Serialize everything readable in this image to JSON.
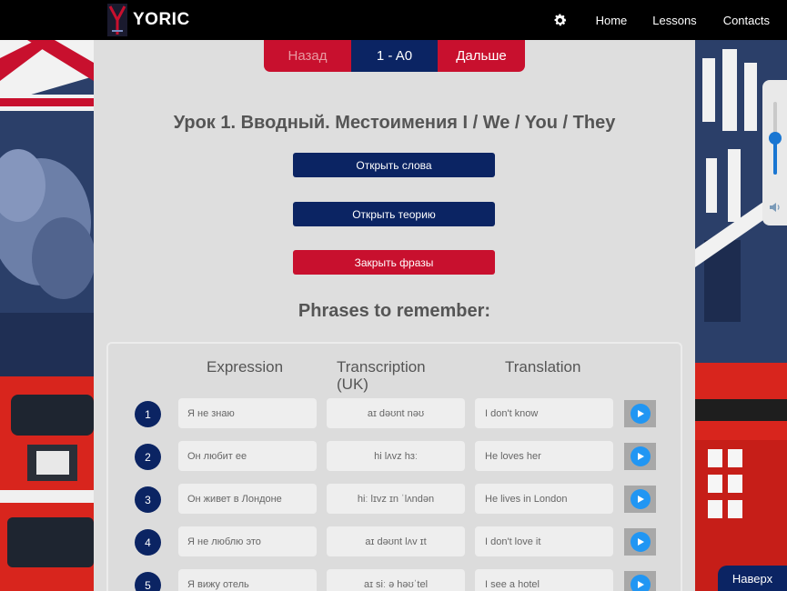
{
  "header": {
    "brand": "YORIC",
    "nav": {
      "home": "Home",
      "lessons": "Lessons",
      "contacts": "Contacts"
    }
  },
  "pager": {
    "prev": "Назад",
    "current": "1 - A0",
    "next": "Дальше"
  },
  "lesson_title": "Урок 1. Вводный. Местоимения I / We / You / They",
  "buttons": {
    "words": "Открыть слова",
    "theory": "Открыть теорию",
    "phrases": "Закрыть фразы"
  },
  "section_title": "Phrases to remember:",
  "table": {
    "headers": {
      "expression": "Expression",
      "transcription": "Transcription (UK)",
      "translation": "Translation"
    },
    "rows": [
      {
        "num": "1",
        "expression": "Я не знаю",
        "transcription": "aɪ dəʊnt nəʊ",
        "translation": "I don't know"
      },
      {
        "num": "2",
        "expression": "Он любит ее",
        "transcription": "hi lʌvz hɜː",
        "translation": "He loves her"
      },
      {
        "num": "3",
        "expression": "Он живет в Лондоне",
        "transcription": "hiː lɪvz ɪn ˈlʌndən",
        "translation": "He lives in London"
      },
      {
        "num": "4",
        "expression": "Я не люблю это",
        "transcription": "aɪ dəʊnt lʌv ɪt",
        "translation": "I don't love it"
      },
      {
        "num": "5",
        "expression": "Я вижу отель",
        "transcription": "aɪ siː ə həʊˈtel",
        "translation": "I see a hotel"
      }
    ]
  },
  "back_to_top": "Наверх",
  "volume": {
    "level": 0.5
  },
  "colors": {
    "accent_red": "#c8102e",
    "accent_navy": "#0b2463",
    "play_blue": "#2196f3"
  },
  "icons": {
    "settings": "gear-icon",
    "play": "play-icon",
    "volume": "speaker-icon"
  }
}
